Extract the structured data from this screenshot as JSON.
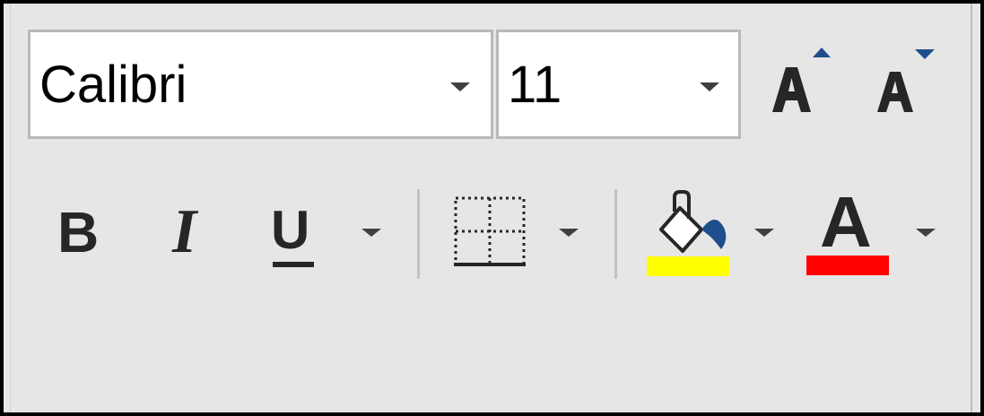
{
  "font_group": {
    "font_name": {
      "value": "Calibri"
    },
    "font_size": {
      "value": "11"
    },
    "increase_font_size": {
      "icon": "grow-font-icon"
    },
    "decrease_font_size": {
      "icon": "shrink-font-icon"
    },
    "bold": {
      "glyph": "B"
    },
    "italic": {
      "glyph": "I"
    },
    "underline": {
      "glyph": "U"
    },
    "font_color": {
      "glyph": "A",
      "color": "#ff0000"
    },
    "fill_color": {
      "icon": "paint-bucket-icon",
      "color": "#ffff00"
    },
    "borders": {
      "icon": "borders-icon"
    }
  },
  "colors": {
    "background": "#e6e6e6",
    "frame": "#000000",
    "dropdown_arrow": "#404040",
    "accent_blue": "#1e4e8c"
  }
}
